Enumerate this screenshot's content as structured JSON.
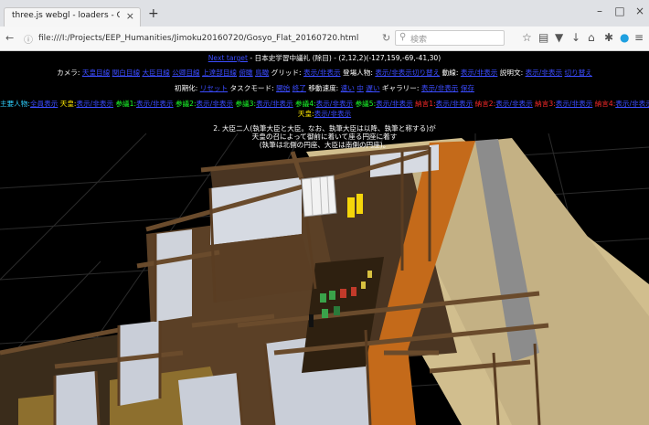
{
  "browser": {
    "tab_title": "three.js webgl - loaders - OBJ ...",
    "tab_close": "×",
    "new_tab": "+",
    "win_min": "–",
    "win_max": "□",
    "win_close": "×",
    "url": "file:///I:/Projects/EEP_Humanities/Jimoku20160720/Gosyo_Flat_20160720.html",
    "search_placeholder": "検索",
    "icons": [
      "back-arrow-icon",
      "info-icon",
      "reload-icon",
      "star-icon",
      "clipboard-icon",
      "pocket-icon",
      "download-icon",
      "home-icon",
      "extension-icon",
      "skype-icon",
      "menu-icon"
    ]
  },
  "viewer": {
    "header": {
      "link": "Next target",
      "title": "- 日本史学習中議礼 (除目) - (2,12,2)(-127,159,-69,-41,30)"
    },
    "row1": {
      "camera_label": "カメラ:",
      "camera_links": [
        "天皇目線",
        "関白目線",
        "大臣目線",
        "公卿目線",
        "上達部目線",
        "俯瞰",
        "鳥瞰"
      ],
      "grid_label": "グリッド:",
      "grid_link": "表示/非表示",
      "people_label": "登場人物:",
      "people_link": "表示/非表示切り替え",
      "motion_label": "動線:",
      "motion_link": "表示/非表示",
      "desc_label": "説明文:",
      "desc_link": "表示/非表示",
      "desc_link2": "切り替え"
    },
    "row2": {
      "init_label": "初期化:",
      "init_link": "リセット",
      "task_label": "タスクモード:",
      "task_links": [
        "開始",
        "終了"
      ],
      "speed_label": "移動速度:",
      "speed_links": [
        "速い",
        "中",
        "遅い"
      ],
      "gallery_label": "ギャラリー:",
      "gallery_links": [
        "表示/非表示",
        "保存"
      ]
    },
    "row3": [
      {
        "label": "主要人物:",
        "cls": "c",
        "link": "全員表示"
      },
      {
        "label": "天皇:",
        "cls": "y",
        "link": "表示/非表示"
      },
      {
        "label": "参議1:",
        "cls": "g",
        "link": "表示/非表示"
      },
      {
        "label": "参議2:",
        "cls": "g",
        "link": "表示/非表示"
      },
      {
        "label": "参議3:",
        "cls": "g",
        "link": "表示/非表示"
      },
      {
        "label": "参議4:",
        "cls": "g",
        "link": "表示/非表示"
      },
      {
        "label": "参議5:",
        "cls": "g",
        "link": "表示/非表示"
      },
      {
        "label": "納言1:",
        "cls": "r",
        "link": "表示/非表示"
      },
      {
        "label": "納言2:",
        "cls": "r",
        "link": "表示/非表示"
      },
      {
        "label": "納言3:",
        "cls": "r",
        "link": "表示/非表示"
      },
      {
        "label": "納言4:",
        "cls": "r",
        "link": "表示/非表示"
      }
    ],
    "row4": {
      "label": "天皇:",
      "link": "表示/非表示"
    },
    "description": [
      "2. 大臣二人(執筆大臣と大臣。なお、執筆大臣は以降、執筆と称する)が",
      "天皇の召によって御前に着いて座る円座に着す",
      "(執筆は北側の円座、大臣は南側の円座)。"
    ]
  }
}
